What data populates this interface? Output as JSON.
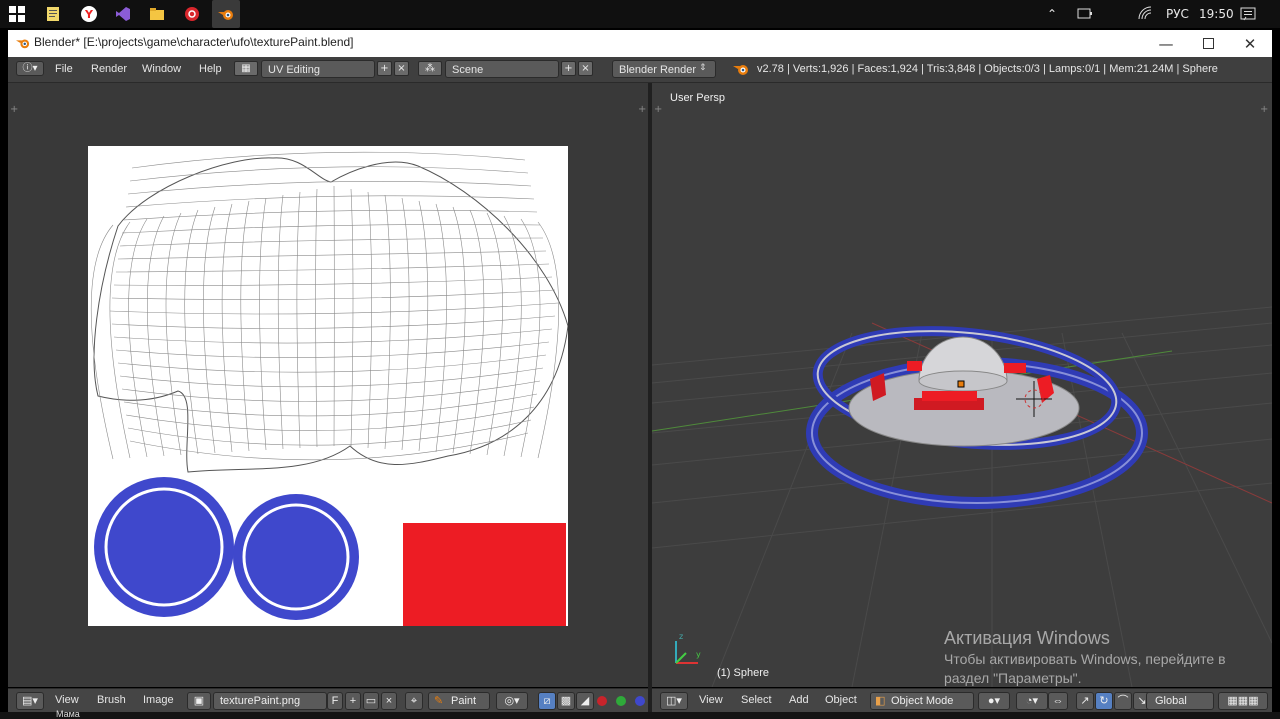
{
  "taskbar": {
    "language": "РУС",
    "time": "19:50"
  },
  "window": {
    "title": "Blender* [E:\\projects\\game\\character\\ufo\\texturePaint.blend]"
  },
  "info_header": {
    "menus": [
      "File",
      "Render",
      "Window",
      "Help"
    ],
    "screen_layout": "UV Editing",
    "scene": "Scene",
    "render_engine": "Blender Render",
    "stats": "v2.78 | Verts:1,926 | Faces:1,924 | Tris:3,848 | Objects:0/3 | Lamps:0/1 | Mem:21.24M | Sphere"
  },
  "viewport": {
    "view_label": "User Persp",
    "object_label": "(1) Sphere"
  },
  "uv_footer": {
    "menus": [
      "View",
      "Brush",
      "Image"
    ],
    "image_name": "texturePaint.png",
    "fake_user": "F",
    "mode": "Paint"
  },
  "viewport_footer": {
    "menus": [
      "View",
      "Select",
      "Add",
      "Object"
    ],
    "mode": "Object Mode",
    "orientation": "Global"
  },
  "activation": {
    "title": "Активация Windows",
    "line1": "Чтобы активировать Windows, перейдите в",
    "line2": "раздел \"Параметры\"."
  },
  "bottom_strip": {
    "user": "Мама"
  },
  "colors": {
    "blue": "#3f48cc",
    "red": "#ed1c24",
    "blender_orange": "#e87d0d"
  }
}
